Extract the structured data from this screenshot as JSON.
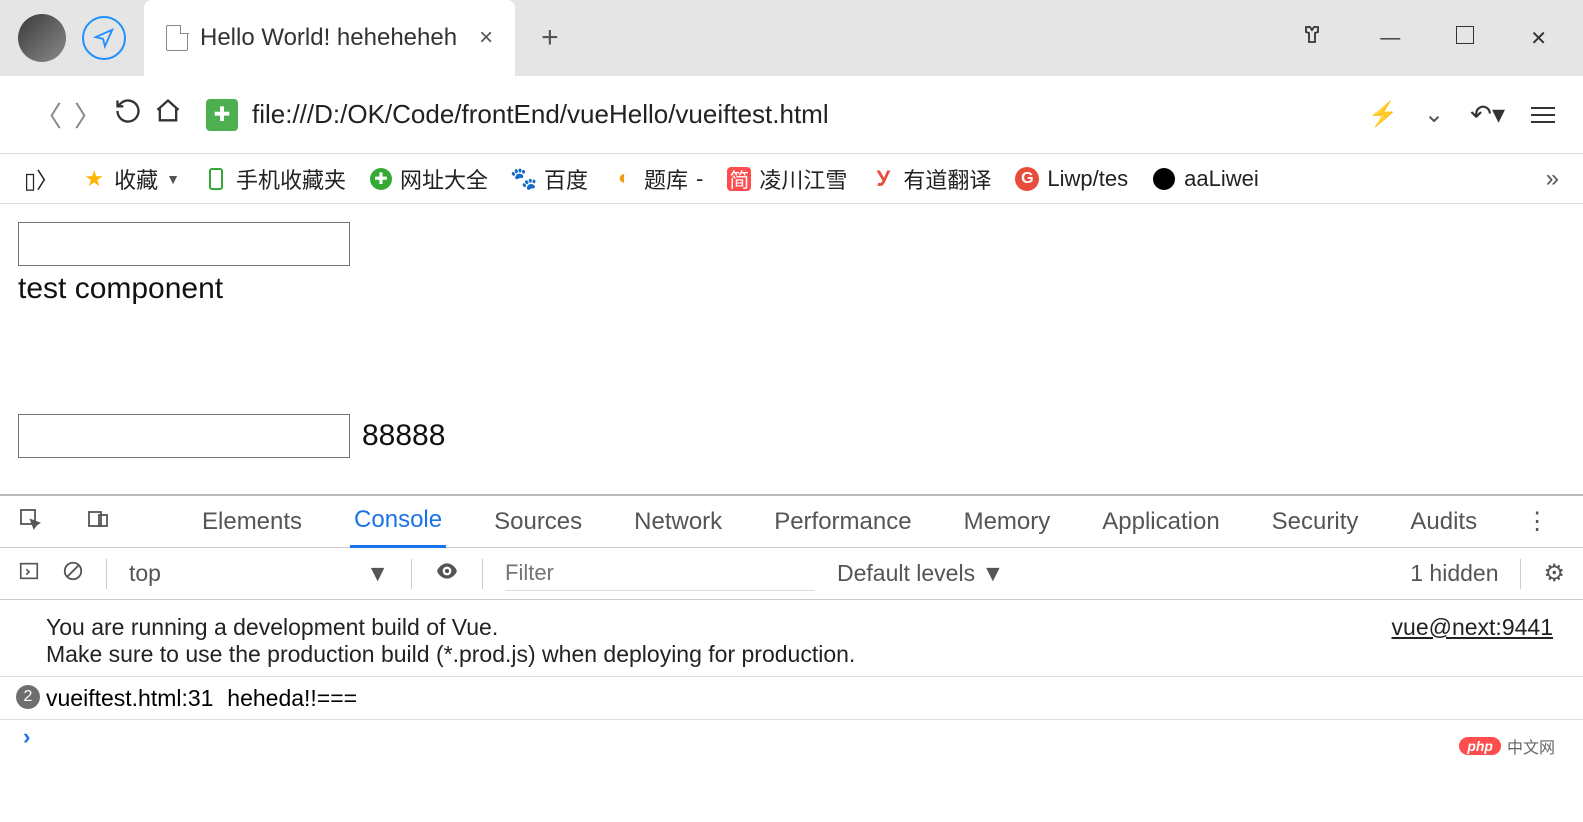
{
  "browser": {
    "tab_title": "Hello World! heheheheh",
    "url": "file:///D:/OK/Code/frontEnd/vueHello/vueiftest.html"
  },
  "bookmarks": {
    "fav": "收藏",
    "mobile": "手机收藏夹",
    "wangzhi": "网址大全",
    "baidu": "百度",
    "tiku": "题库",
    "lingchuan": "凌川江雪",
    "youdao": "有道翻译",
    "liwp": "Liwp/tes",
    "aaliwei": "aaLiwei"
  },
  "page": {
    "input1_value": "",
    "text1": "test component",
    "input2_value": "",
    "value2": "88888"
  },
  "devtools": {
    "tabs": {
      "elements": "Elements",
      "console": "Console",
      "sources": "Sources",
      "network": "Network",
      "performance": "Performance",
      "memory": "Memory",
      "application": "Application",
      "security": "Security",
      "audits": "Audits"
    },
    "toolbar": {
      "context": "top",
      "filter_placeholder": "Filter",
      "levels": "Default levels ▼",
      "hidden": "1 hidden"
    },
    "console_lines": {
      "line1": "You are running a development build of Vue.",
      "line2": "Make sure to use the production build (*.prod.js) when deploying for production.",
      "source1": "vue@next:9441",
      "badge_count": "2",
      "line3": "heheda!!===",
      "source2": "vueiftest.html:31"
    }
  },
  "watermark": {
    "badge": "php",
    "text": "中文网"
  }
}
